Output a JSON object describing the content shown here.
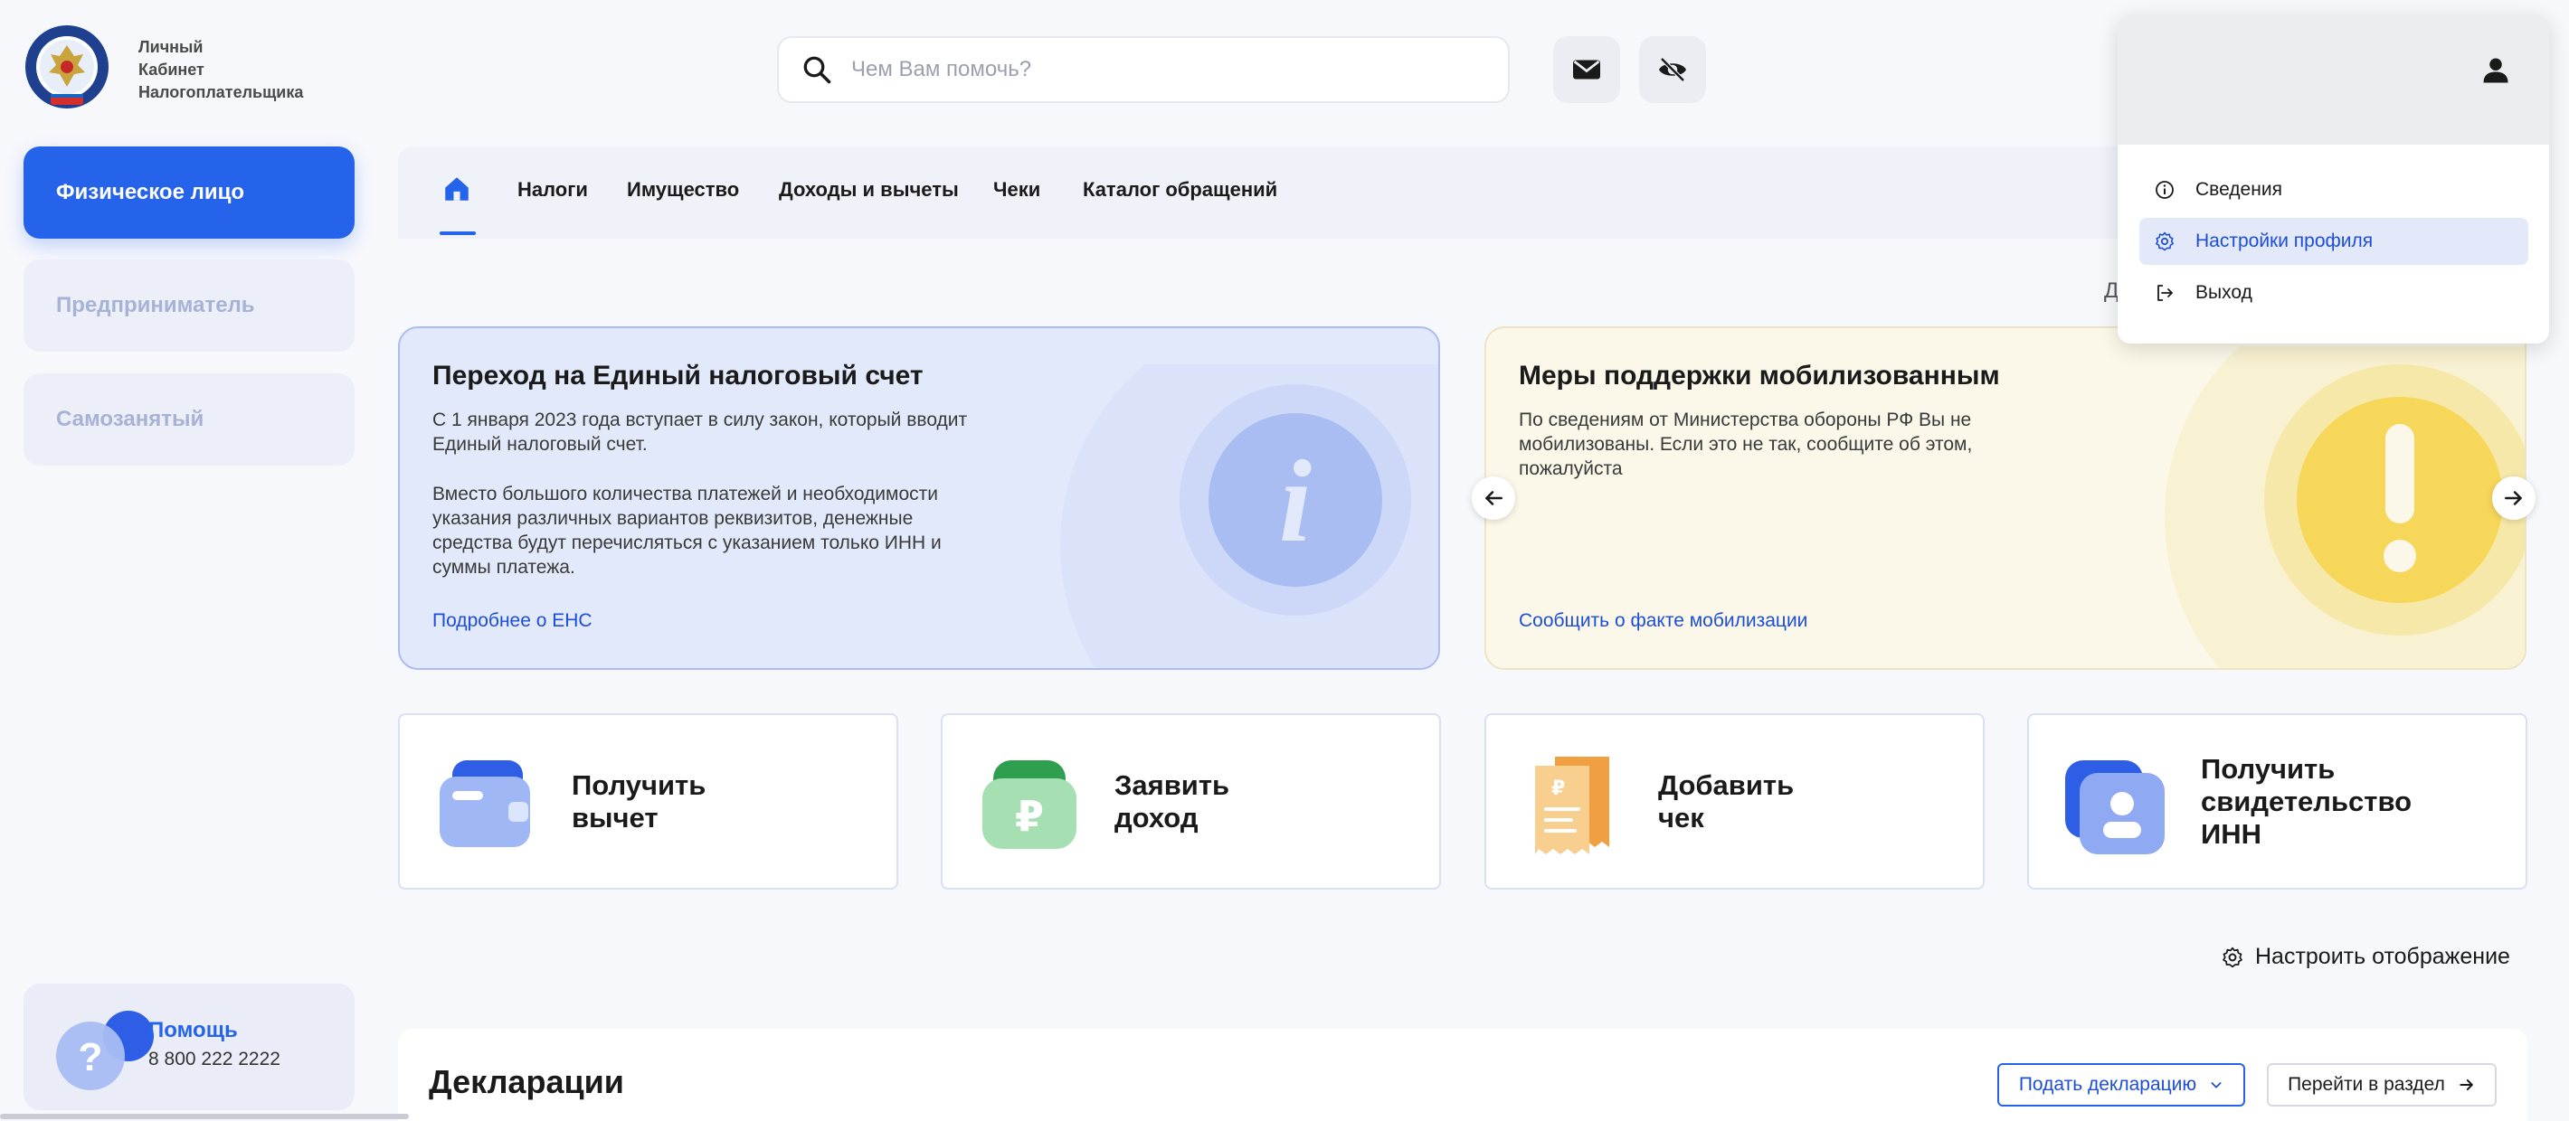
{
  "header": {
    "logo_text": [
      "Личный",
      "Кабинет",
      "Налогоплательщика"
    ],
    "search_placeholder": "Чем Вам помочь?"
  },
  "sidebar": {
    "items": [
      {
        "label": "Физическое лицо",
        "active": true
      },
      {
        "label": "Предприниматель",
        "active": false
      },
      {
        "label": "Самозанятый",
        "active": false
      }
    ],
    "help": {
      "title": "Помощь",
      "phone": "8 800 222 2222"
    }
  },
  "nav": {
    "items": [
      "Налоги",
      "Имущество",
      "Доходы и вычеты",
      "Чеки",
      "Каталог обращений"
    ]
  },
  "truncated_text": "Д",
  "banners": [
    {
      "title": "Переход на Единый налоговый счет",
      "para1": "С 1 января 2023 года вступает в силу закон, который вводит Единый налоговый счет.",
      "para2": "Вместо большого количества платежей и необходимости указания различных вариантов реквизитов, денежные средства будут перечисляться с указанием только ИНН и суммы платежа.",
      "link": "Подробнее о ЕНС"
    },
    {
      "title": "Меры поддержки мобилизованным",
      "para1": "По сведениям от Министерства обороны РФ Вы не мобилизованы. Если это не так, сообщите об этом, пожалуйста",
      "link": "Сообщить о факте мобилизации"
    }
  ],
  "quick_actions": [
    {
      "line1": "Получить",
      "line2": "вычет",
      "line3": ""
    },
    {
      "line1": "Заявить",
      "line2": "доход",
      "line3": ""
    },
    {
      "line1": "Добавить",
      "line2": "чек",
      "line3": ""
    },
    {
      "line1": "Получить",
      "line2": "свидетельство",
      "line3": "ИНН"
    }
  ],
  "configure_label": "Настроить отображение",
  "declarations": {
    "title": "Декларации",
    "submit_label": "Подать декларацию",
    "goto_label": "Перейти в раздел"
  },
  "profile_menu": {
    "items": [
      {
        "label": "Сведения",
        "icon": "info-icon",
        "active": false
      },
      {
        "label": "Настройки профиля",
        "icon": "gear-icon",
        "active": true
      },
      {
        "label": "Выход",
        "icon": "logout-icon",
        "active": false
      }
    ]
  },
  "colors": {
    "accent": "#2563eb",
    "link": "#1d4ed8",
    "banner_blue": "#e2e9fb",
    "banner_yellow": "#fbf8e9"
  }
}
